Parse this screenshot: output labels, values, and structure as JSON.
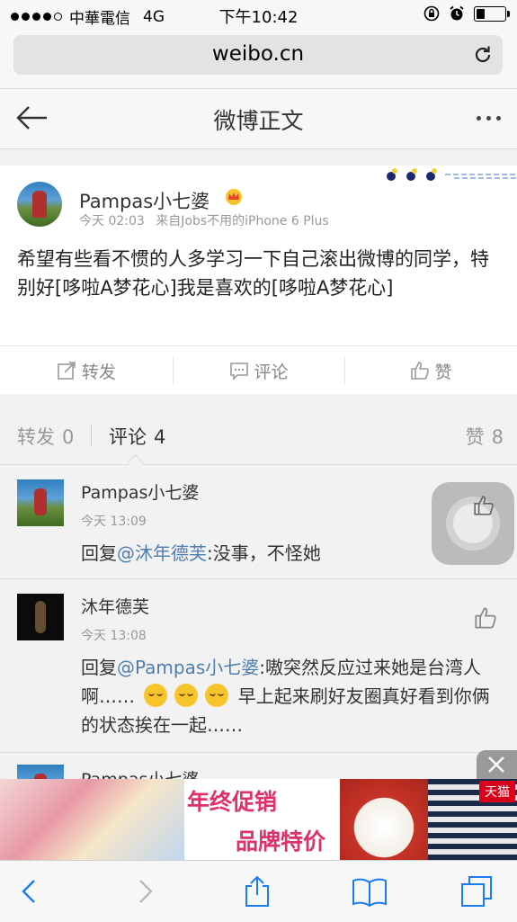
{
  "status_bar": {
    "carrier": "中華電信",
    "network": "4G",
    "time": "下午10:42"
  },
  "browser": {
    "url": "weibo.cn"
  },
  "header": {
    "title": "微博正文"
  },
  "post": {
    "author": "Pampas小七婆",
    "time": "今天 02:03",
    "source": "来自Jobs不用的iPhone 6 Plus",
    "text": "希望有些看不惯的人多学习一下自己滚出微博的同学，特别好[哆啦A梦花心]我是喜欢的[哆啦A梦花心]",
    "actions": {
      "repost": "转发",
      "comment": "评论",
      "like": "赞"
    }
  },
  "tabs": {
    "repost_label": "转发",
    "repost_count": "0",
    "comment_label": "评论",
    "comment_count": "4",
    "like_label": "赞",
    "like_count": "8"
  },
  "comments": [
    {
      "name": "Pampas小七婆",
      "time": "今天 13:09",
      "prefix": "回复",
      "mention": "@沐年德芙",
      "body": ":没事，不怪她"
    },
    {
      "name": "沐年德芙",
      "time": "今天 13:08",
      "prefix": "回复",
      "mention": "@Pampas小七婆",
      "body": ":嗷突然反应过来她是台湾人啊……",
      "body_after": "早上起来刷好友圈真好看到你俩的状态挨在一起……"
    },
    {
      "name": "Pampas小七婆"
    }
  ],
  "ad": {
    "line1": "年终促销",
    "line2": "品牌特价",
    "store_badge": "天猫"
  },
  "colors": {
    "link": "#507daf",
    "ad_text": "#e0306a",
    "ios_blue": "#1a7cf5"
  }
}
